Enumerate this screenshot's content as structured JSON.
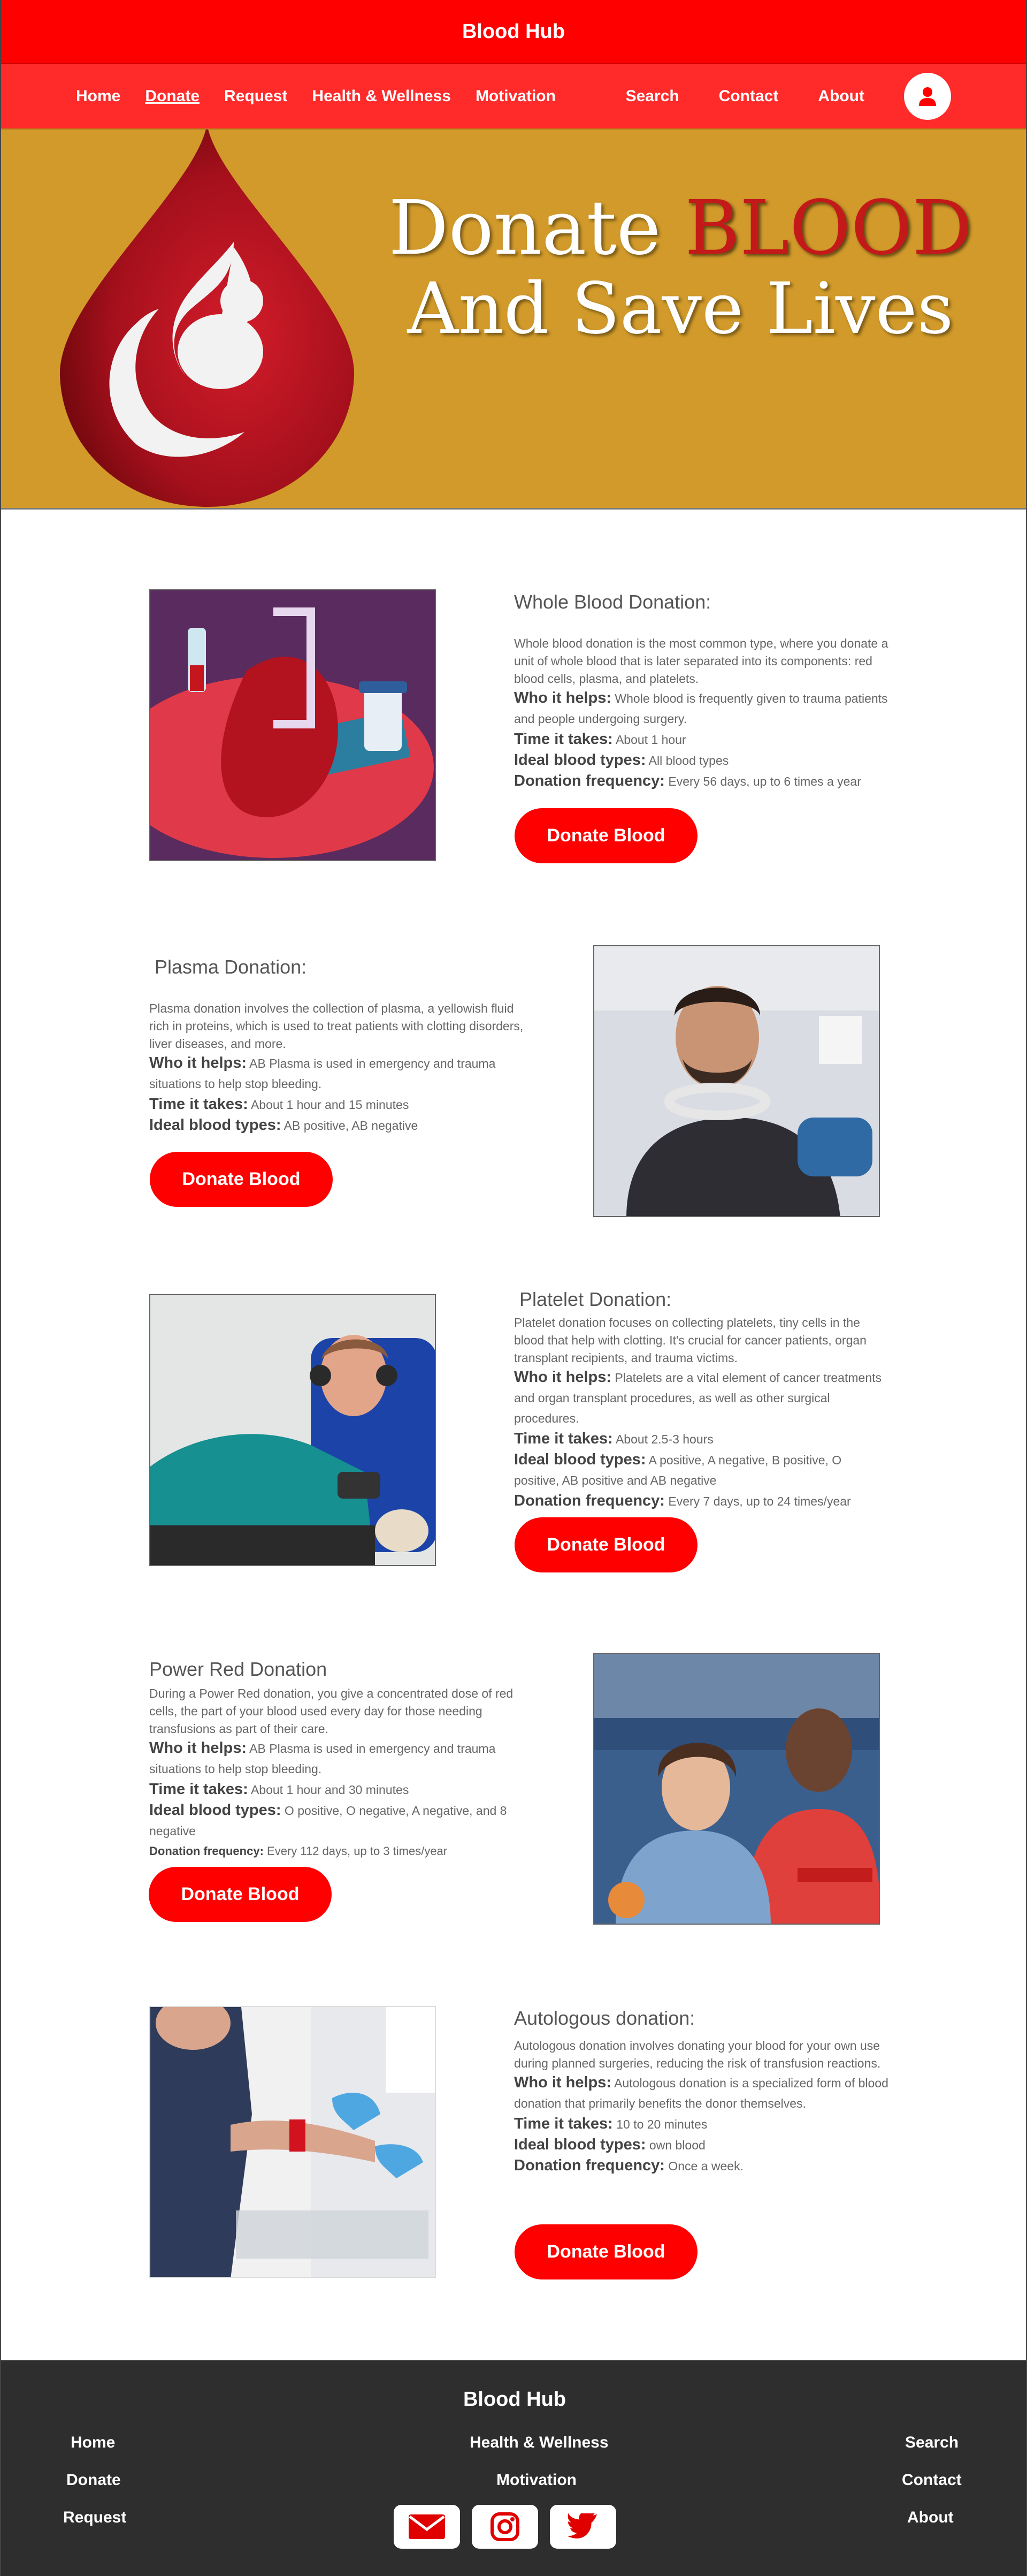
{
  "brand": "Blood Hub",
  "nav": {
    "home": "Home",
    "donate": "Donate",
    "request": "Request",
    "health": "Health & Wellness",
    "motivation": "Motivation",
    "search": "Search",
    "contact": "Contact",
    "about": "About"
  },
  "hero": {
    "line1_a": "Donate ",
    "line1_b": "BLOOD",
    "line2": "And Save Lives"
  },
  "sections": [
    {
      "title": "Whole Blood Donation:",
      "description": "Whole blood donation is the most common type, where you donate a unit of whole blood that is later separated into its components: red blood cells, plasma, and platelets.",
      "helps_label": "Who it helps:",
      "helps": "Whole blood is frequently given to trauma patients and people undergoing surgery.",
      "time_label": "Time it takes:",
      "time": "About 1 hour",
      "types_label": "Ideal blood types:",
      "types": "All blood types",
      "freq_label": "Donation frequency:",
      "freq": "Every 56 days, up to 6 times a year",
      "button": "Donate Blood"
    },
    {
      "title": "Plasma Donation:",
      "description": "Plasma donation involves the collection of plasma, a yellowish fluid rich in proteins, which is used to treat patients with clotting disorders, liver diseases, and more.",
      "helps_label": "Who it helps:",
      "helps": "AB Plasma is used in emergency and trauma situations to help stop bleeding.",
      "time_label": "Time it takes:",
      "time": "About 1 hour and 15 minutes",
      "types_label": "Ideal blood types:",
      "types": "AB positive, AB negative",
      "button": "Donate Blood"
    },
    {
      "title": "Platelet Donation:",
      "description": "Platelet donation focuses on collecting platelets, tiny cells in the blood that help with clotting. It's crucial for cancer patients, organ transplant recipients, and trauma victims.",
      "helps_label": "Who it helps:",
      "helps": "Platelets are a vital element of cancer treatments and organ transplant procedures, as well as other surgical procedures.",
      "time_label": "Time it takes:",
      "time": "About 2.5-3 hours",
      "types_label": "Ideal blood types:",
      "types": "A positive, A negative, B positive, O positive, AB positive and AB negative",
      "freq_label": "Donation frequency:",
      "freq": "Every 7 days, up to 24 times/year",
      "button": "Donate Blood"
    },
    {
      "title": "Power Red Donation",
      "description": "During a Power Red donation, you give a concentrated dose of red cells, the part of your blood used every day for those needing transfusions as part of their care.",
      "helps_label": "Who it helps:",
      "helps": "AB Plasma is used in emergency and trauma situations to help stop bleeding.",
      "time_label": "Time it takes:",
      "time": "About 1 hour and 30 minutes",
      "types_label": "Ideal blood types:",
      "types": "O positive, O negative, A negative, and 8 negative",
      "freq_label": "Donation frequency:",
      "freq": "Every 112 days, up to 3 times/year",
      "button": "Donate Blood"
    },
    {
      "title": "Autologous donation:",
      "description": "Autologous donation involves donating your blood for your own use during planned surgeries, reducing the risk of transfusion reactions.",
      "helps_label": "Who it helps:",
      "helps": "Autologous donation is a specialized form of blood donation that primarily benefits the donor themselves.",
      "time_label": "Time it takes:",
      "time": "10 to 20 minutes",
      "types_label": "Ideal blood types:",
      "types": "own  blood",
      "freq_label": "Donation frequency:",
      "freq": "Once a week.",
      "button": "Donate Blood"
    }
  ],
  "footer": {
    "title": "Blood Hub",
    "home": "Home",
    "donate": "Donate",
    "request": "Request",
    "health": "Health & Wellness",
    "motivation": "Motivation",
    "search": "Search",
    "contact": "Contact",
    "about": "About"
  },
  "colors": {
    "primary_red": "#ff0000",
    "nav_red": "#ff2a2a",
    "hero_gold": "#d19a2a",
    "footer_dark": "#2e2e2e"
  },
  "icons": [
    "user-icon",
    "mail-icon",
    "instagram-icon",
    "twitter-icon",
    "blood-drop-logo"
  ]
}
